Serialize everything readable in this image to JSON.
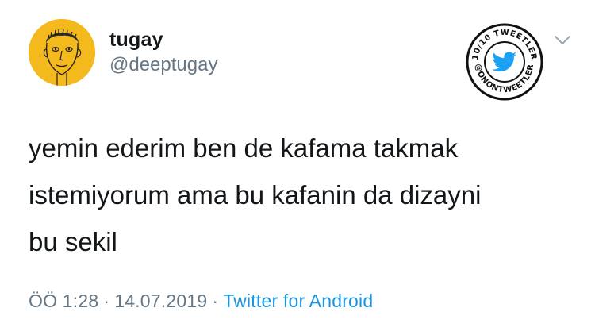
{
  "user": {
    "display_name": "tugay",
    "handle": "@deeptugay"
  },
  "badge": {
    "top_text": "10/10 TWEETLER",
    "bottom_text": "@ONONTWEETLER",
    "icon": "twitter-bird-icon",
    "color": "#1da1f2"
  },
  "tweet": {
    "text": "yemin ederim ben de kafama takmak\nistemiyorum ama bu kafanin da dizayni\nbu sekil"
  },
  "meta": {
    "time": "ÖÖ 1:28",
    "separator": "·",
    "date": "14.07.2019",
    "source": "Twitter for Android"
  },
  "colors": {
    "text_primary": "#14171a",
    "text_secondary": "#657786",
    "link": "#1b95e0",
    "avatar_bg": "#f4b91d"
  }
}
